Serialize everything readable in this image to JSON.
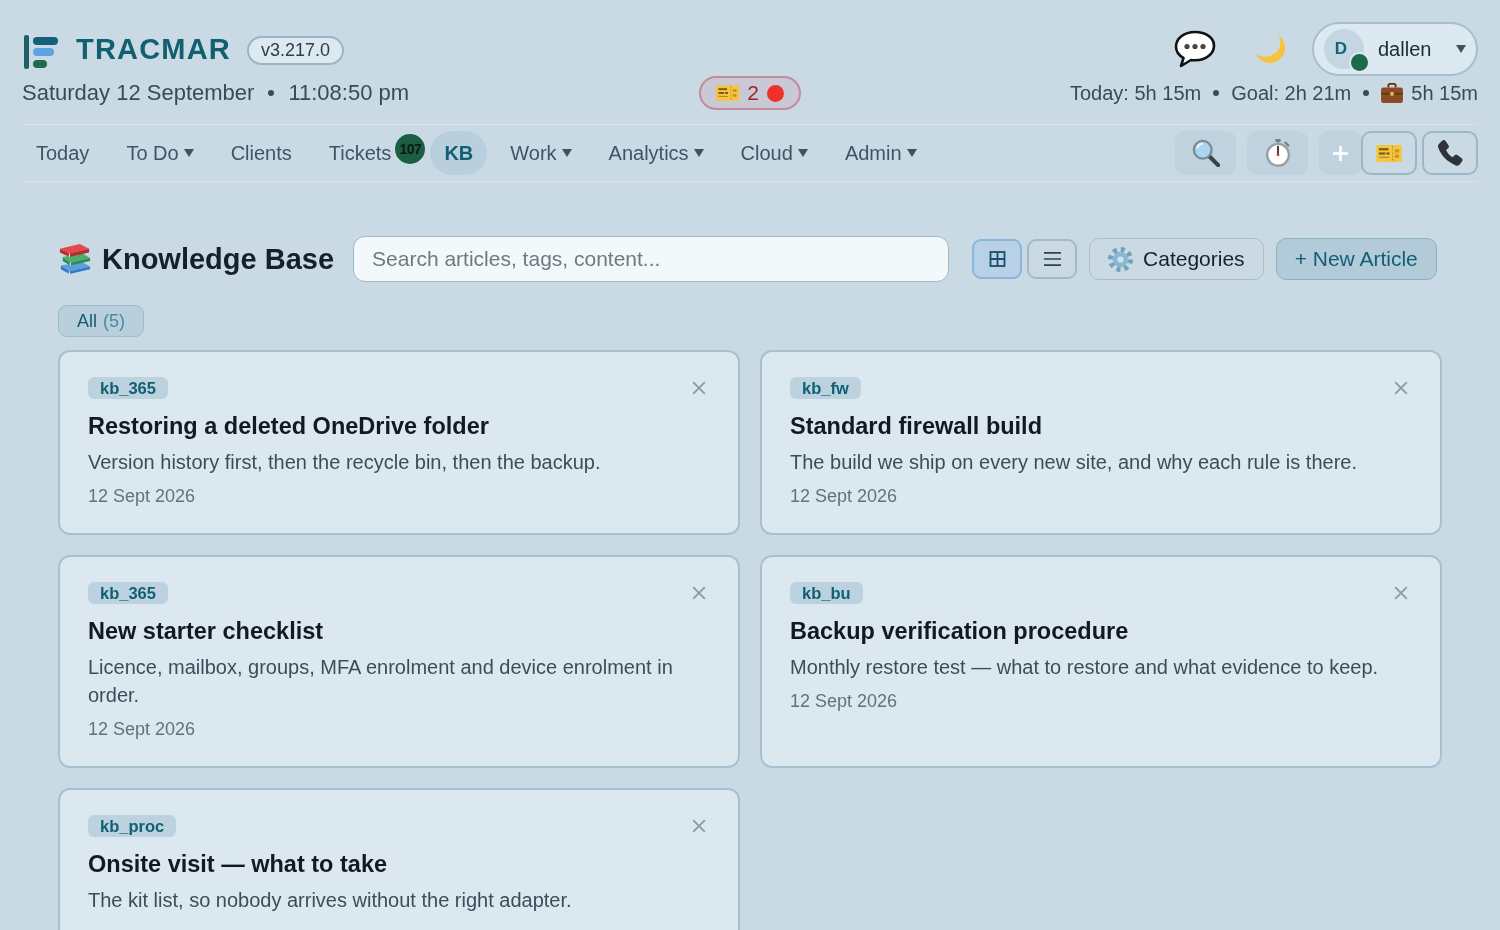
{
  "header": {
    "app_name": "TRACMAR",
    "version": "v3.217.0",
    "date": "Saturday 12 September",
    "time": "11:08:50 pm",
    "alert": {
      "count": "2"
    },
    "user": {
      "initial": "D",
      "name": "dallen",
      "online": true
    },
    "stats": [
      {
        "kind": "plain",
        "text": "Today: 5h 15m"
      },
      {
        "kind": "plain",
        "text": "Goal: 2h 21m"
      },
      {
        "kind": "work",
        "text": "5h 15m"
      }
    ]
  },
  "nav": {
    "items": [
      {
        "label": "Today",
        "dropdown": false,
        "selected": false
      },
      {
        "label": "To Do",
        "dropdown": true,
        "selected": false
      },
      {
        "label": "Clients",
        "dropdown": false,
        "selected": false
      },
      {
        "label": "Tickets",
        "dropdown": false,
        "selected": false,
        "badge": "107"
      },
      {
        "label": "KB",
        "dropdown": false,
        "selected": true
      },
      {
        "label": "Work",
        "dropdown": true,
        "selected": false
      },
      {
        "label": "Analytics",
        "dropdown": true,
        "selected": false
      },
      {
        "label": "Cloud",
        "dropdown": true,
        "selected": false
      },
      {
        "label": "Admin",
        "dropdown": true,
        "selected": false
      }
    ],
    "tools": [
      {
        "kind": "search"
      },
      {
        "kind": "timer"
      },
      {
        "kind": "add"
      },
      {
        "kind": "ticket"
      },
      {
        "kind": "phone"
      }
    ]
  },
  "kb": {
    "title": "Knowledge Base",
    "search": {
      "placeholder": "Search articles, tags, content..."
    },
    "views": [
      {
        "kind": "grid",
        "selected": true
      },
      {
        "kind": "list",
        "selected": false
      }
    ],
    "categories_button": "Categories",
    "new_button": "+ New Article",
    "filters": [
      {
        "label": "All",
        "count": "(5)",
        "selected": true
      }
    ],
    "articles": [
      {
        "tag": "kb_365",
        "title": "Restoring a deleted OneDrive folder",
        "summary": "Version history first, then the recycle bin, then the backup.",
        "date": "12 Sept 2026"
      },
      {
        "tag": "kb_fw",
        "title": "Standard firewall build",
        "summary": "The build we ship on every new site, and why each rule is there.",
        "date": "12 Sept 2026"
      },
      {
        "tag": "kb_365",
        "title": "New starter checklist",
        "summary": "Licence, mailbox, groups, MFA enrolment and device enrolment in order.",
        "date": "12 Sept 2026"
      },
      {
        "tag": "kb_bu",
        "title": "Backup verification procedure",
        "summary": "Monthly restore test — what to restore and what evidence to keep.",
        "date": "12 Sept 2026"
      },
      {
        "tag": "kb_proc",
        "title": "Onsite visit — what to take",
        "summary": "The kit list, so nobody arrives without the right adapter."
      }
    ]
  }
}
